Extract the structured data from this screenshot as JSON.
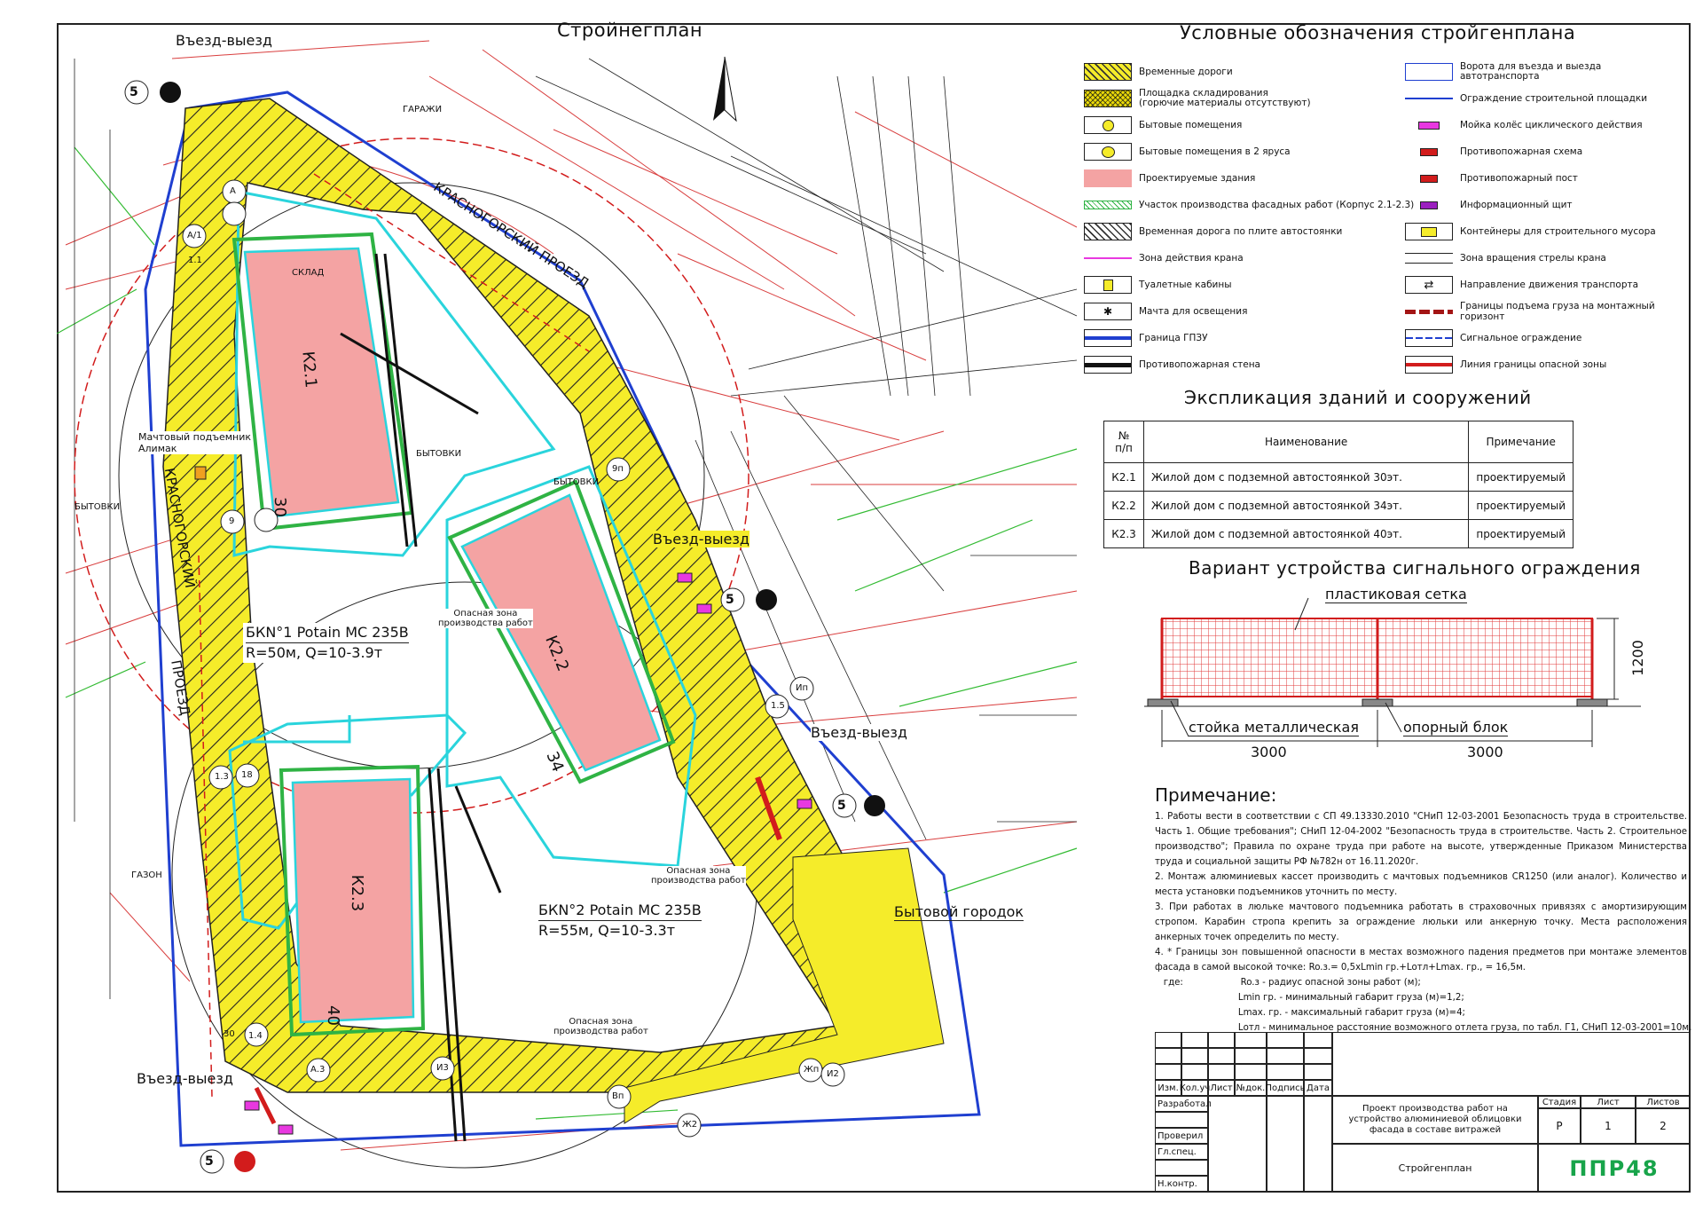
{
  "plan_title": "Стройнегплан",
  "legend": {
    "title": "Условные обозначения стройгенплана",
    "left": [
      "Временные дороги",
      "Площадка складирования\n(горючие материалы отсутствуют)",
      "Бытовые помещения",
      "Бытовые помещения в 2 яруса",
      "Проектируемые здания",
      "Участок производства фасадных работ (Корпус 2.1-2.3)",
      "Временная дорога по плите автостоянки",
      "Зона действия крана",
      "Туалетные кабины",
      "Мачта для освещения",
      "Граница ГПЗУ",
      "Противопожарная стена"
    ],
    "right": [
      "Ворота для въезда и выезда автотранспорта",
      "Ограждение строительной площадки",
      "Мойка колёс циклического действия",
      "Противопожарная схема",
      "Противопожарный пост",
      "Информационный щит",
      "Контейнеры для строительного мусора",
      "Зона вращения стрелы крана",
      "Направление движения транспорта",
      "Границы подъема груза на монтажный горизонт",
      "Сигнальное ограждение",
      "Линия границы опасной зоны"
    ]
  },
  "explication": {
    "title": "Экспликация зданий и сооружений",
    "headers": [
      "№ п/п",
      "Наименование",
      "Примечание"
    ],
    "rows": [
      [
        "К2.1",
        "Жилой дом с подземной автостоянкой 30эт.",
        "проектируемый"
      ],
      [
        "К2.2",
        "Жилой дом с подземной автостоянкой 34эт.",
        "проектируемый"
      ],
      [
        "К2.3",
        "Жилой дом с подземной автостоянкой 40эт.",
        "проектируемый"
      ]
    ]
  },
  "signal_fence": {
    "title": "Вариант устройства сигнального ограждения",
    "mesh": "пластиковая сетка",
    "post": "стойка металлическая",
    "block": "опорный блок",
    "height": "1200",
    "span1": "3000",
    "span2": "3000"
  },
  "notes": {
    "title": "Примечание:",
    "items": [
      "1.        Работы вести в соответствии с СП 49.13330.2010 \"СНиП 12-03-2001 Безопасность труда в строительстве. Часть 1. Общие требования\"; СНиП 12-04-2002 \"Безопасность труда в строительстве. Часть 2. Строительное производство\"; Правила по охране труда при работе на высоте, утвержденные Приказом Министерства труда и социальной защиты РФ №782н от 16.11.2020г.",
      "2.        Монтаж алюминиевых кассет производить с мачтовых подъемников CR1250 (или аналог). Количество и места установки подъемников уточнить по месту.",
      "3.        При работах в люльке мачтового подъемника работать в страховочных привязях с амортизирующим стропом. Карабин стропа крепить за ограждение люльки или анкерную точку. Места расположения анкерных точек определить по месту.",
      "4.        * Границы зон повышенной опасности в местах возможного падения предметов при монтаже элементов фасада в самой высокой точке:          Ro.з.= 0,5xLmin гр.+Lотл+Lmax. гр., = 16,5м.",
      "   где:                    Ro.з - радиус опасной зоны работ (м);",
      "                             Lmin гр. - минимальный габарит груза (м)=1,2;",
      "                             Lmax. гр. - максимальный габарит груза (м)=4;",
      "                             Lотл - минимальное расстояние возможного отлета груза, по табл. Г1, СНиП 12-03-2001=10м."
    ]
  },
  "stamp": {
    "cols": [
      "Изм.",
      "Кол.уч",
      "Лист",
      "№док.",
      "Подпись",
      "Дата"
    ],
    "roles": [
      "Разработал",
      "",
      "Проверил",
      "Гл.спец.",
      "",
      "Н.контр."
    ],
    "project": "Проект производства работ на устройство алюминиевой облицовки фасада в составе витражей",
    "sheet_name": "Стройгенплан",
    "stage_label": "Стадия",
    "sheet_label": "Лист",
    "sheets_label": "Листов",
    "stage": "Р",
    "sheet": "1",
    "sheets": "2",
    "logo": "ППР48"
  },
  "plan": {
    "buildings": [
      "К2.1",
      "К2.2",
      "К2.3"
    ],
    "floors": [
      "30",
      "34",
      "40"
    ],
    "crane1": [
      "БКN°1 Potain MC 235B",
      "R=50м, Q=10-3.9т"
    ],
    "crane2": [
      "БКN°2 Potain MC 235B",
      "R=55м, Q=10-3.3т"
    ],
    "danger_zone": "Опасная зона\nпроизводства работ",
    "entries": [
      "Въезд-выезд",
      "Въезд-выезд",
      "Въезд-выезд",
      "Въезд-выезд"
    ],
    "camp": "Бытовой городок",
    "street1": "КРАСНОГОРСКИЙ ПРОЕЗД",
    "street2": "КРАСНОГОРСКИЙ",
    "street3": "ПРОЕЗД",
    "lift": "Мачтовый подъемник\nАлимак",
    "garages": "ГАРАЖИ",
    "lawn": "ГАЗОН",
    "cabins": "БЫТОВКИ",
    "store": "СКЛАД",
    "axes": [
      "А/1",
      "А",
      "1.1",
      "9",
      "1.3",
      "18",
      "30",
      "1.4",
      "А.3",
      "И3",
      "Вп",
      "Ж2",
      "И2",
      "Жп",
      "Ип",
      "9п",
      "1.5"
    ],
    "gate_nums": [
      "5",
      "5",
      "5",
      "5"
    ]
  },
  "colors": {
    "road": "#f5ec2a",
    "building": "#f4a3a3",
    "facade": "#2fb344",
    "crane_zone": "#2ad4dc",
    "fence": "#1f3fd0",
    "red_lines": "#d21c1c",
    "green_lines": "#33bb33",
    "logo": "#18a44a"
  }
}
